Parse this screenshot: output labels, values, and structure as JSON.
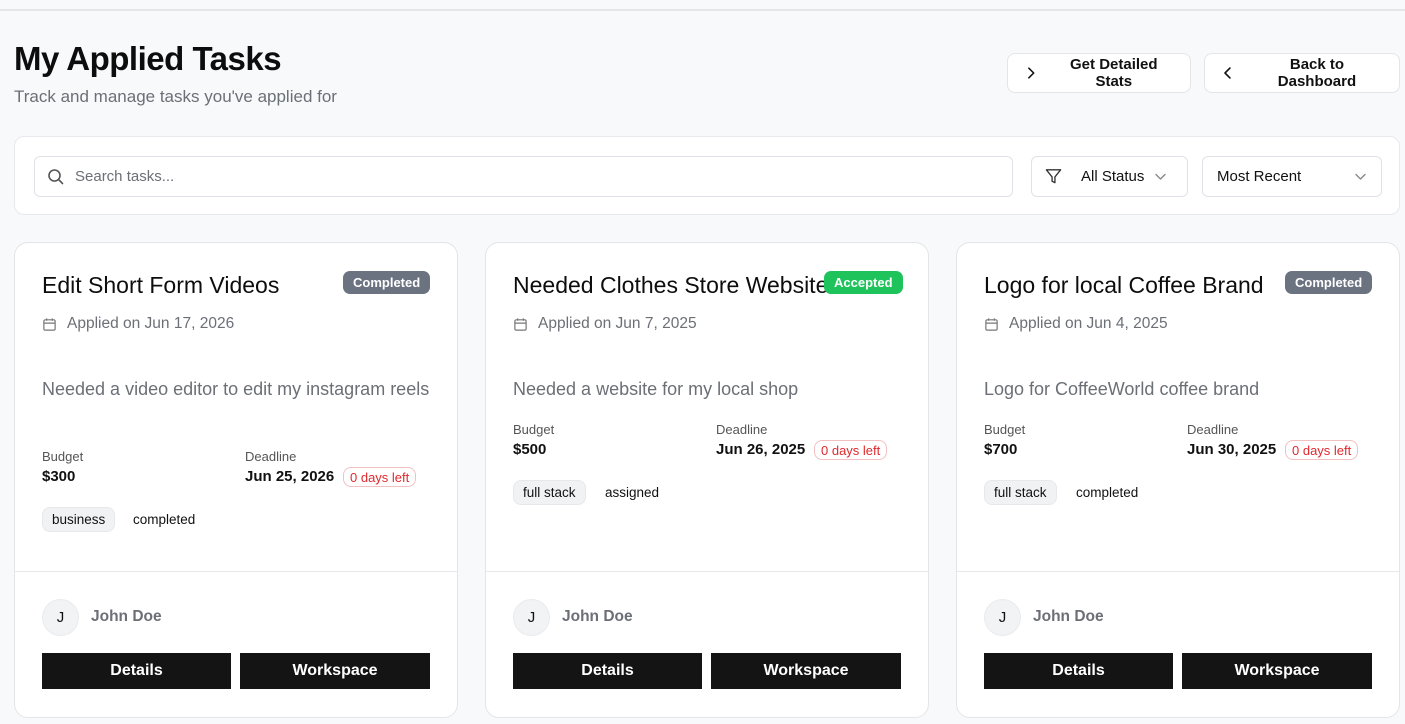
{
  "header": {
    "title": "My Applied Tasks",
    "subtitle": "Track and manage tasks you've applied for",
    "stats_button": "Get Detailed Stats",
    "back_button": "Back to Dashboard"
  },
  "filters": {
    "search_placeholder": "Search tasks...",
    "status_value": "All Status",
    "sort_value": "Most Recent"
  },
  "colors": {
    "completed": "#6b7280",
    "accepted": "#1ec35c",
    "danger": "#e0292e",
    "button_dark": "#141414"
  },
  "icons": {
    "stats": "chevron-right-icon",
    "back": "chevron-left-icon",
    "search": "search-icon",
    "filter": "filter-icon",
    "dropdown": "chevron-down-icon",
    "date": "calendar-icon"
  },
  "cards": [
    {
      "title": "Edit Short Form Videos",
      "status": "Completed",
      "applied": "Applied on Jun 17, 2026",
      "description": "Needed a video editor to edit my instagram reels",
      "budget_label": "Budget",
      "budget": "$300",
      "deadline_label": "Deadline",
      "deadline": "Jun 25, 2026",
      "days_left": "0 days left",
      "tags": [
        "business",
        "completed"
      ],
      "owner_initial": "J",
      "owner": "John Doe",
      "details_label": "Details",
      "workspace_label": "Workspace"
    },
    {
      "title": "Needed Clothes Store Website",
      "status": "Accepted",
      "applied": "Applied on Jun 7, 2025",
      "description": "Needed a website for my local shop",
      "budget_label": "Budget",
      "budget": "$500",
      "deadline_label": "Deadline",
      "deadline": "Jun 26, 2025",
      "days_left": "0 days left",
      "tags": [
        "full stack",
        "assigned"
      ],
      "owner_initial": "J",
      "owner": "John Doe",
      "details_label": "Details",
      "workspace_label": "Workspace"
    },
    {
      "title": "Logo for local Coffee Brand",
      "status": "Completed",
      "applied": "Applied on Jun 4, 2025",
      "description": "Logo for CoffeeWorld coffee brand",
      "budget_label": "Budget",
      "budget": "$700",
      "deadline_label": "Deadline",
      "deadline": "Jun 30, 2025",
      "days_left": "0 days left",
      "tags": [
        "full stack",
        "completed"
      ],
      "owner_initial": "J",
      "owner": "John Doe",
      "details_label": "Details",
      "workspace_label": "Workspace"
    }
  ]
}
